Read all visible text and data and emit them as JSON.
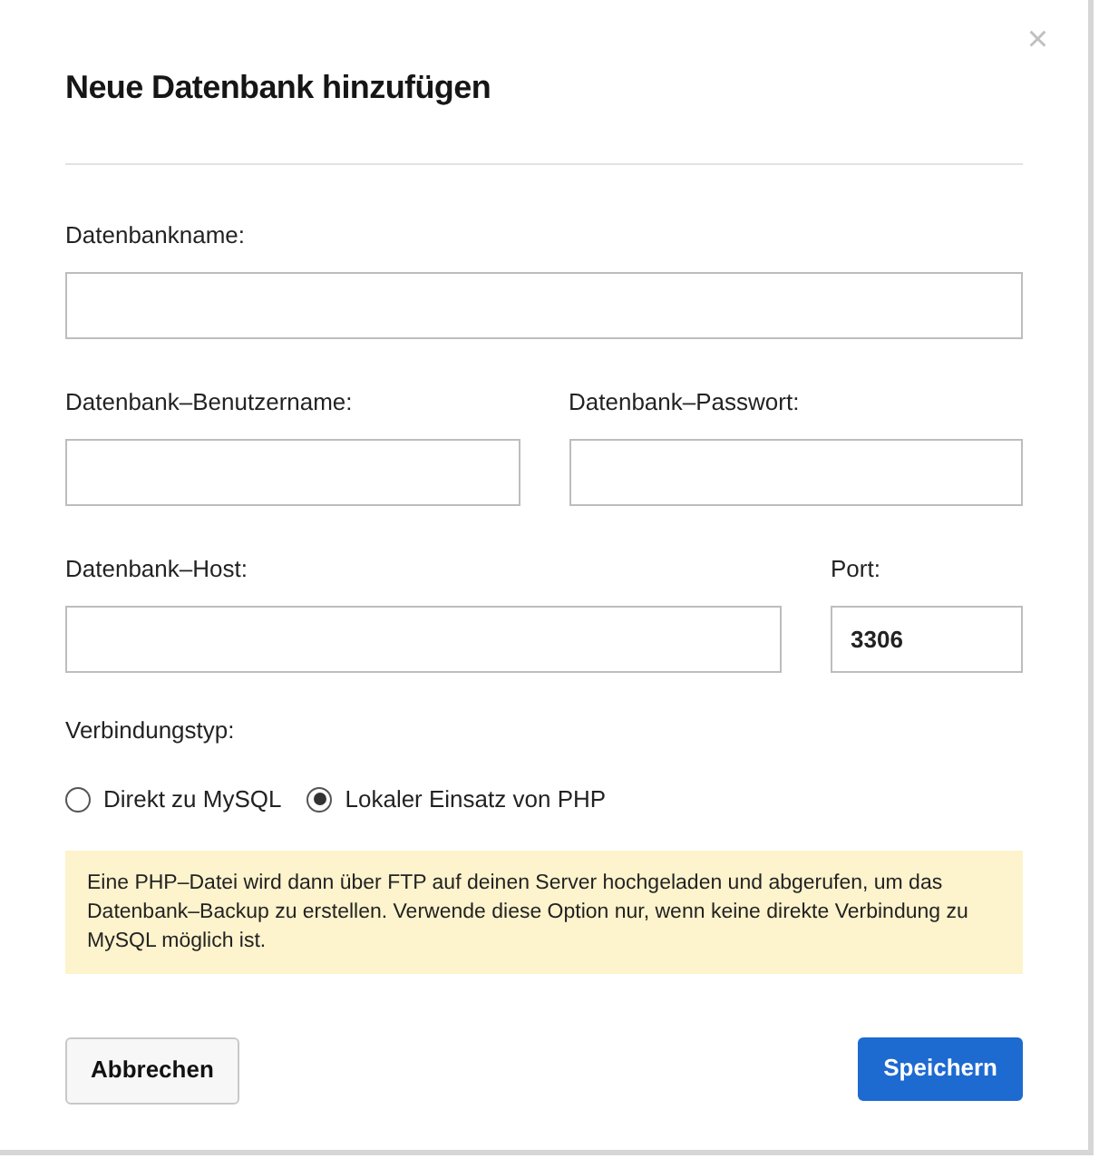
{
  "dialog": {
    "title": "Neue Datenbank hinzufügen",
    "close": "×"
  },
  "field_rows": [
    [
      {
        "label": "Datenbankname:",
        "kind": "text"
      }
    ],
    [
      {
        "label": "Datenbank–Benutzername:",
        "kind": "text"
      },
      {
        "label": "Datenbank–Passwort:",
        "kind": "text"
      }
    ],
    [
      {
        "label": "Datenbank–Host:",
        "kind": "text"
      },
      {
        "label": "Port:",
        "value": "3306",
        "kind": "port"
      }
    ]
  ],
  "connection": {
    "label": "Verbindungstyp:",
    "options": [
      {
        "label": "Direkt zu MySQL",
        "selected": false
      },
      {
        "label": "Lokaler Einsatz von PHP",
        "selected": true
      }
    ]
  },
  "notice": "Eine PHP–Datei wird dann über FTP auf deinen Server hochgeladen und abgerufen, um das Datenbank–Backup zu erstellen. Verwende diese Option nur, wenn keine direkte Verbindung zu MySQL möglich ist.",
  "buttons": [
    {
      "label": "Abbrechen",
      "kind": "secondary"
    },
    {
      "label": "Speichern",
      "kind": "primary"
    }
  ]
}
